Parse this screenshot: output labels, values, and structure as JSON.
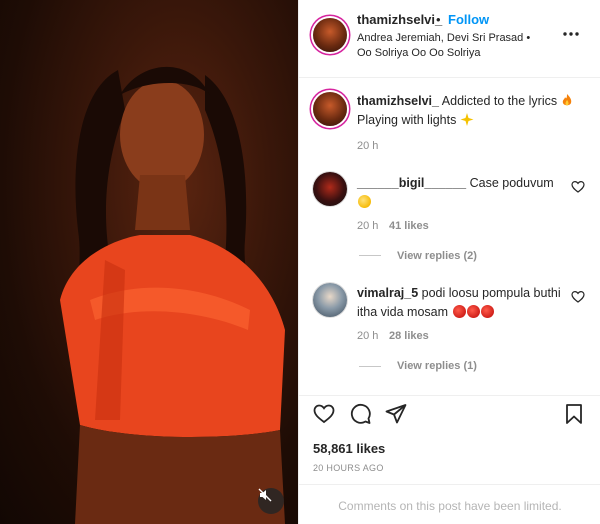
{
  "header": {
    "username": "thamizhselvi_",
    "separator": "•",
    "follow_label": "Follow",
    "audio": "Andrea Jeremiah, Devi Sri Prasad • Oo Solriya Oo Oo Solriya",
    "more_icon": "more-horizontal-icon"
  },
  "caption": {
    "username": "thamizhselvi_",
    "text_line1": "Addicted to the lyrics",
    "text_line2": "Playing with lights",
    "time": "20 h"
  },
  "comments": [
    {
      "username": "______bigil______",
      "text": "Case poduvum",
      "time": "20 h",
      "likes": "41 likes",
      "view_replies": "View replies (2)"
    },
    {
      "username": "vimalraj_5",
      "text": "podi loosu pompula buthi itha vida mosam",
      "time": "20 h",
      "likes": "28 likes",
      "view_replies": "View replies (1)"
    }
  ],
  "actions": {
    "icons": [
      "heart-icon",
      "comment-icon",
      "share-icon",
      "bookmark-icon"
    ],
    "likes": "58,861 likes",
    "posted": "20 HOURS AGO"
  },
  "footer": {
    "limited_text": "Comments on this post have been limited."
  },
  "media": {
    "mute_icon": "muted-speaker-icon"
  }
}
